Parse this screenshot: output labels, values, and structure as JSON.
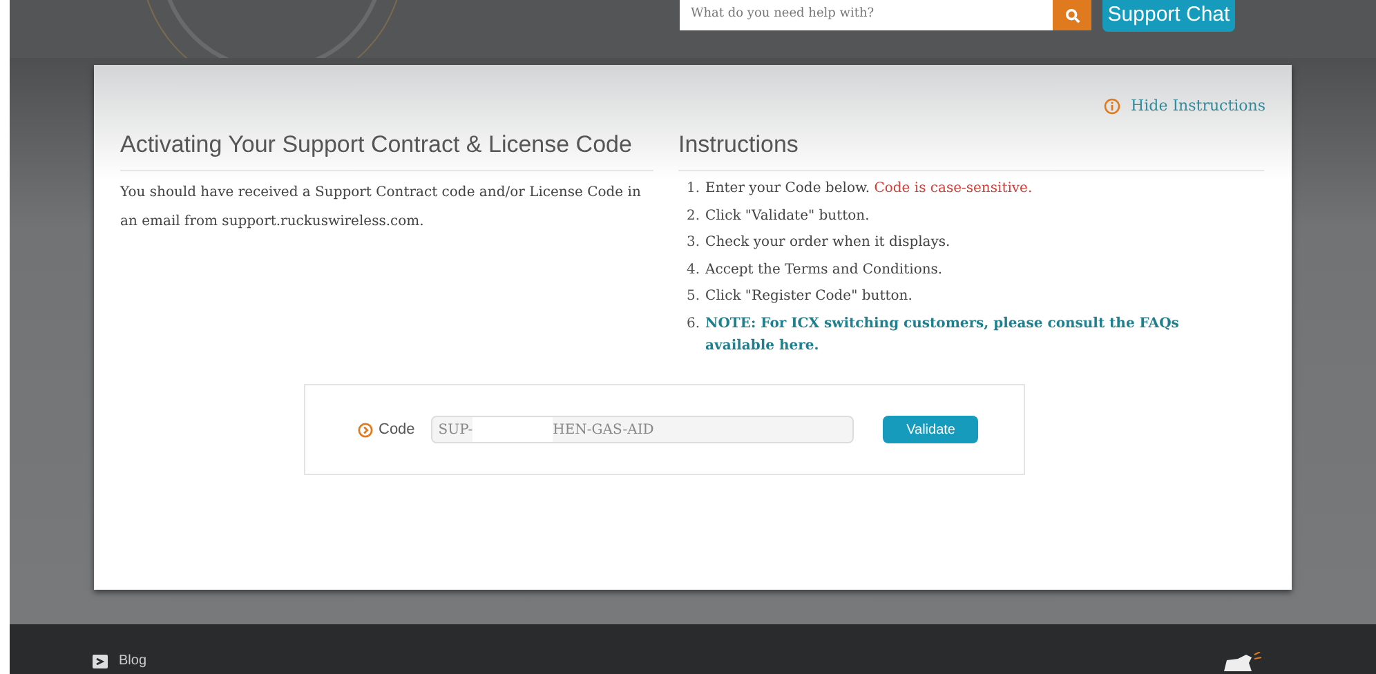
{
  "header": {
    "search": {
      "placeholder": "What do you need help with?"
    },
    "chat_button": "Support Chat"
  },
  "card": {
    "hide_link": "Hide Instructions",
    "left": {
      "title": "Activating Your Support Contract & License Code",
      "body": "You should have received a Support Contract code and/or License Code in an email from support.ruckuswireless.com."
    },
    "instructions": {
      "title": "Instructions",
      "items": [
        {
          "number": "1.",
          "kind": "plain",
          "text": "Enter your Code below.",
          "warning": "Code is case-sensitive."
        },
        {
          "number": "2.",
          "kind": "plain",
          "text": "Click \"Validate\" button."
        },
        {
          "number": "3.",
          "kind": "plain",
          "text": "Check your order when it displays."
        },
        {
          "number": "4.",
          "kind": "plain",
          "text": "Accept the Terms and Conditions."
        },
        {
          "number": "5.",
          "kind": "plain",
          "text": "Click \"Register Code\" button."
        },
        {
          "number": "6.",
          "kind": "note",
          "text": "NOTE: For ICX  switching customers, please consult the FAQs available here."
        }
      ]
    },
    "code_form": {
      "label": "Code",
      "value_start": "SUP-",
      "value_end": "HEN-GAS-AID",
      "button": "Validate"
    }
  },
  "footer": {
    "blog": "Blog"
  }
}
